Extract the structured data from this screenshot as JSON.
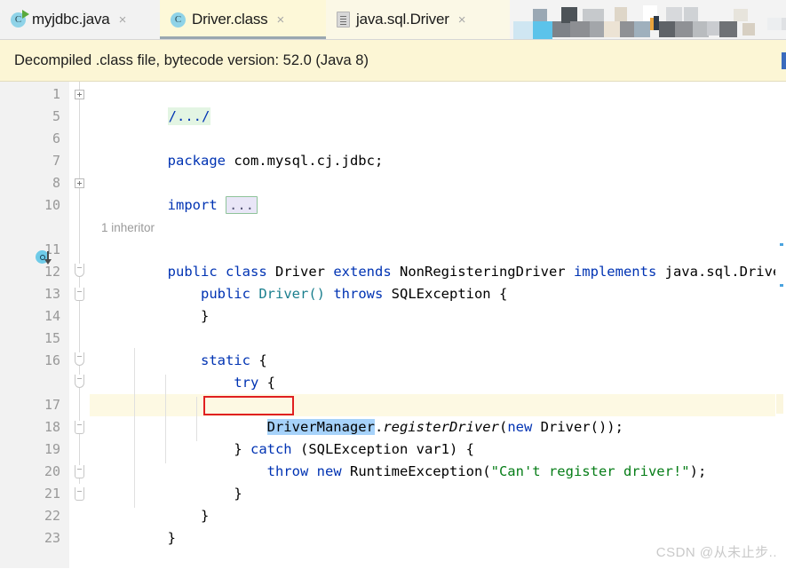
{
  "window": {
    "app": "IntelliJ IDEA Editor",
    "watermark": "CSDN @从未止步.."
  },
  "tabs": [
    {
      "label": "myjdbc.java",
      "icon": "java-class-runnable-icon",
      "close": "×",
      "active": false,
      "state": "inactive"
    },
    {
      "label": "Driver.class",
      "icon": "java-class-icon",
      "close": "×",
      "active": true,
      "state": "active"
    },
    {
      "label": "java.sql.Driver",
      "icon": "decompiled-file-icon",
      "close": "×",
      "active": false,
      "state": "pale"
    }
  ],
  "notification": {
    "text": "Decompiled .class file, bytecode version: 52.0 (Java 8)",
    "link_truncated": ""
  },
  "editor": {
    "line_numbers": [
      "1",
      "5",
      "6",
      "7",
      "8",
      "10",
      "11",
      "12",
      "13",
      "14",
      "15",
      "16",
      "17",
      "18",
      "19",
      "20",
      "21",
      "22",
      "23"
    ],
    "code_vision_hint": "1 inheritor",
    "selection": "DriverManager",
    "lines": [
      {
        "n": "1",
        "type": "fold-comment",
        "text": "/.../"
      },
      {
        "n": "5",
        "type": "blank",
        "text": ""
      },
      {
        "n": "6",
        "type": "code",
        "text": "package com.mysql.cj.jdbc;"
      },
      {
        "n": "7",
        "type": "blank",
        "text": ""
      },
      {
        "n": "8",
        "type": "fold-import",
        "text": "import ..."
      },
      {
        "n": "10",
        "type": "blank",
        "text": ""
      },
      {
        "n": "11",
        "type": "code",
        "text": "public class Driver extends NonRegisteringDriver implements java.sql.Driver {"
      },
      {
        "n": "12",
        "type": "code",
        "text": "    public Driver() throws SQLException {"
      },
      {
        "n": "13",
        "type": "code",
        "text": "    }"
      },
      {
        "n": "14",
        "type": "blank",
        "text": ""
      },
      {
        "n": "15",
        "type": "code",
        "text": "    static {"
      },
      {
        "n": "16",
        "type": "code",
        "text": "        try {"
      },
      {
        "n": "17",
        "type": "code",
        "text": "            DriverManager.registerDriver(new Driver());"
      },
      {
        "n": "18",
        "type": "code",
        "text": "        } catch (SQLException var1) {"
      },
      {
        "n": "19",
        "type": "code",
        "text": "            throw new RuntimeException(\"Can't register driver!\");"
      },
      {
        "n": "20",
        "type": "code",
        "text": "        }"
      },
      {
        "n": "21",
        "type": "code",
        "text": "    }"
      },
      {
        "n": "22",
        "type": "code",
        "text": "}"
      },
      {
        "n": "23",
        "type": "blank",
        "text": ""
      }
    ],
    "tokens": {
      "l6_kw": "package",
      "l6_rest": " com.mysql.cj.jdbc;",
      "l8_kw": "import",
      "l8_fold": "...",
      "l11_a": "public",
      "l11_b": " ",
      "l11_c": "class",
      "l11_d": " Driver ",
      "l11_e": "extends",
      "l11_f": " NonRegisteringDriver ",
      "l11_g": "implements",
      "l11_h": " java.sql.Driver {",
      "l12_a": "public",
      "l12_b": " ",
      "l12_ctor": "Driver()",
      "l12_c": " ",
      "l12_d": "throws",
      "l12_e": " SQLException {",
      "l13": "}",
      "l15_kw": "static",
      "l15_rest": " {",
      "l16_kw": "try",
      "l16_rest": " {",
      "l17_sel": "DriverManager",
      "l17_dot": ".",
      "l17_m": "registerDriver",
      "l17_p1": "(",
      "l17_new": "new",
      "l17_p2": " Driver());",
      "l18_a": "} ",
      "l18_kw": "catch",
      "l18_b": " (SQLException var1) {",
      "l19_kw1": "throw",
      "l19_sp": " ",
      "l19_kw2": "new",
      "l19_a": " RuntimeException(",
      "l19_str": "\"Can't register driver!\"",
      "l19_b": ");",
      "l20": "}",
      "l21": "}",
      "l22": "}"
    }
  },
  "colors": {
    "keyword": "#0033b3",
    "string": "#067d17",
    "constructor": "#1a7f8e",
    "selection": "#a6d2fa",
    "selection_border": "#e02020",
    "highlight_line": "#fdf9e3",
    "notification_bg": "#fcf6d5",
    "active_tab_bg": "#fdf8d8",
    "fold_comment_bg": "#e3f5e3",
    "fold_import_bg": "#e9e6f7",
    "bulb": "#f2a516",
    "gutter_bg": "#f2f2f2"
  }
}
